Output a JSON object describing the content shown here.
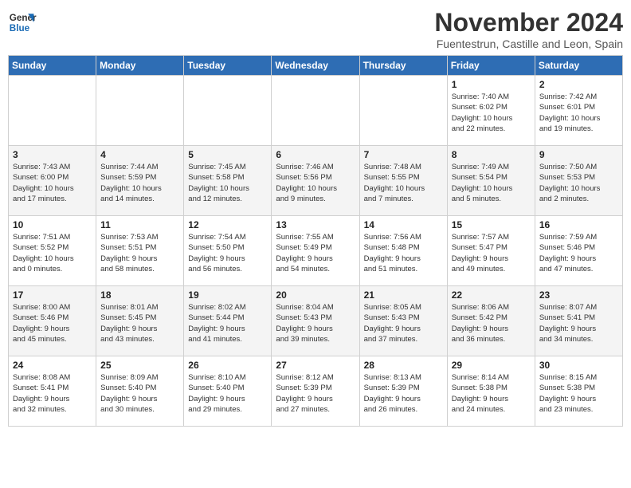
{
  "logo": {
    "line1": "General",
    "line2": "Blue"
  },
  "title": "November 2024",
  "location": "Fuentestrun, Castille and Leon, Spain",
  "days_of_week": [
    "Sunday",
    "Monday",
    "Tuesday",
    "Wednesday",
    "Thursday",
    "Friday",
    "Saturday"
  ],
  "weeks": [
    [
      {
        "day": "",
        "info": ""
      },
      {
        "day": "",
        "info": ""
      },
      {
        "day": "",
        "info": ""
      },
      {
        "day": "",
        "info": ""
      },
      {
        "day": "",
        "info": ""
      },
      {
        "day": "1",
        "info": "Sunrise: 7:40 AM\nSunset: 6:02 PM\nDaylight: 10 hours\nand 22 minutes."
      },
      {
        "day": "2",
        "info": "Sunrise: 7:42 AM\nSunset: 6:01 PM\nDaylight: 10 hours\nand 19 minutes."
      }
    ],
    [
      {
        "day": "3",
        "info": "Sunrise: 7:43 AM\nSunset: 6:00 PM\nDaylight: 10 hours\nand 17 minutes."
      },
      {
        "day": "4",
        "info": "Sunrise: 7:44 AM\nSunset: 5:59 PM\nDaylight: 10 hours\nand 14 minutes."
      },
      {
        "day": "5",
        "info": "Sunrise: 7:45 AM\nSunset: 5:58 PM\nDaylight: 10 hours\nand 12 minutes."
      },
      {
        "day": "6",
        "info": "Sunrise: 7:46 AM\nSunset: 5:56 PM\nDaylight: 10 hours\nand 9 minutes."
      },
      {
        "day": "7",
        "info": "Sunrise: 7:48 AM\nSunset: 5:55 PM\nDaylight: 10 hours\nand 7 minutes."
      },
      {
        "day": "8",
        "info": "Sunrise: 7:49 AM\nSunset: 5:54 PM\nDaylight: 10 hours\nand 5 minutes."
      },
      {
        "day": "9",
        "info": "Sunrise: 7:50 AM\nSunset: 5:53 PM\nDaylight: 10 hours\nand 2 minutes."
      }
    ],
    [
      {
        "day": "10",
        "info": "Sunrise: 7:51 AM\nSunset: 5:52 PM\nDaylight: 10 hours\nand 0 minutes."
      },
      {
        "day": "11",
        "info": "Sunrise: 7:53 AM\nSunset: 5:51 PM\nDaylight: 9 hours\nand 58 minutes."
      },
      {
        "day": "12",
        "info": "Sunrise: 7:54 AM\nSunset: 5:50 PM\nDaylight: 9 hours\nand 56 minutes."
      },
      {
        "day": "13",
        "info": "Sunrise: 7:55 AM\nSunset: 5:49 PM\nDaylight: 9 hours\nand 54 minutes."
      },
      {
        "day": "14",
        "info": "Sunrise: 7:56 AM\nSunset: 5:48 PM\nDaylight: 9 hours\nand 51 minutes."
      },
      {
        "day": "15",
        "info": "Sunrise: 7:57 AM\nSunset: 5:47 PM\nDaylight: 9 hours\nand 49 minutes."
      },
      {
        "day": "16",
        "info": "Sunrise: 7:59 AM\nSunset: 5:46 PM\nDaylight: 9 hours\nand 47 minutes."
      }
    ],
    [
      {
        "day": "17",
        "info": "Sunrise: 8:00 AM\nSunset: 5:46 PM\nDaylight: 9 hours\nand 45 minutes."
      },
      {
        "day": "18",
        "info": "Sunrise: 8:01 AM\nSunset: 5:45 PM\nDaylight: 9 hours\nand 43 minutes."
      },
      {
        "day": "19",
        "info": "Sunrise: 8:02 AM\nSunset: 5:44 PM\nDaylight: 9 hours\nand 41 minutes."
      },
      {
        "day": "20",
        "info": "Sunrise: 8:04 AM\nSunset: 5:43 PM\nDaylight: 9 hours\nand 39 minutes."
      },
      {
        "day": "21",
        "info": "Sunrise: 8:05 AM\nSunset: 5:43 PM\nDaylight: 9 hours\nand 37 minutes."
      },
      {
        "day": "22",
        "info": "Sunrise: 8:06 AM\nSunset: 5:42 PM\nDaylight: 9 hours\nand 36 minutes."
      },
      {
        "day": "23",
        "info": "Sunrise: 8:07 AM\nSunset: 5:41 PM\nDaylight: 9 hours\nand 34 minutes."
      }
    ],
    [
      {
        "day": "24",
        "info": "Sunrise: 8:08 AM\nSunset: 5:41 PM\nDaylight: 9 hours\nand 32 minutes."
      },
      {
        "day": "25",
        "info": "Sunrise: 8:09 AM\nSunset: 5:40 PM\nDaylight: 9 hours\nand 30 minutes."
      },
      {
        "day": "26",
        "info": "Sunrise: 8:10 AM\nSunset: 5:40 PM\nDaylight: 9 hours\nand 29 minutes."
      },
      {
        "day": "27",
        "info": "Sunrise: 8:12 AM\nSunset: 5:39 PM\nDaylight: 9 hours\nand 27 minutes."
      },
      {
        "day": "28",
        "info": "Sunrise: 8:13 AM\nSunset: 5:39 PM\nDaylight: 9 hours\nand 26 minutes."
      },
      {
        "day": "29",
        "info": "Sunrise: 8:14 AM\nSunset: 5:38 PM\nDaylight: 9 hours\nand 24 minutes."
      },
      {
        "day": "30",
        "info": "Sunrise: 8:15 AM\nSunset: 5:38 PM\nDaylight: 9 hours\nand 23 minutes."
      }
    ]
  ]
}
